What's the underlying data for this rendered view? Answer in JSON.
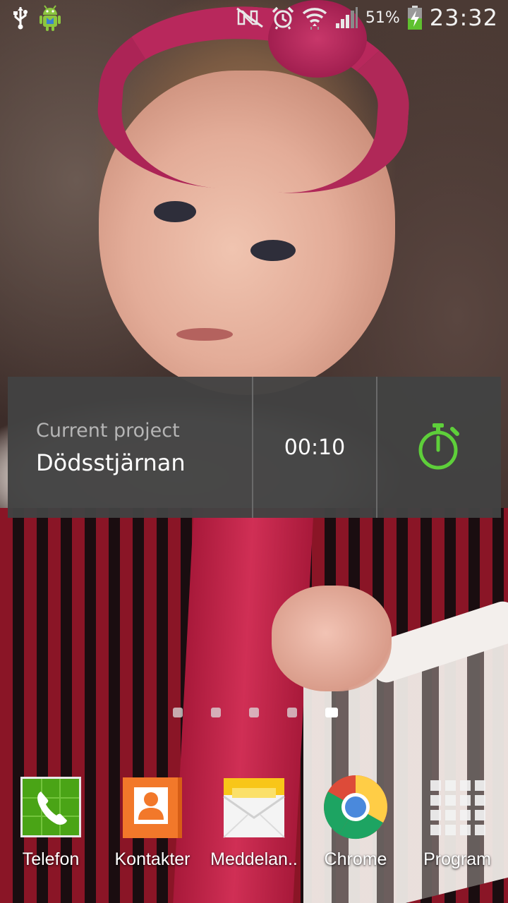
{
  "status_bar": {
    "left_icons": [
      "usb-icon",
      "android-debug-icon"
    ],
    "right_icons": [
      "nfc-muted-icon",
      "alarm-icon",
      "wifi-icon",
      "signal-icon",
      "battery-charging-icon"
    ],
    "battery_percent": "51%",
    "battery_level": 0.51,
    "clock": "23:32"
  },
  "widget": {
    "project_label": "Current project",
    "project_name": "Dödsstjärnan",
    "elapsed_time": "00:10",
    "start_icon": "stopwatch-icon",
    "accent_color": "#5ecf3a"
  },
  "pager": {
    "page_count": 5,
    "active_page": 5
  },
  "dock": {
    "items": [
      {
        "label": "Telefon",
        "icon": "phone-icon"
      },
      {
        "label": "Kontakter",
        "icon": "contacts-icon"
      },
      {
        "label": "Meddelan..",
        "icon": "messages-icon"
      },
      {
        "label": "Chrome",
        "icon": "chrome-icon"
      },
      {
        "label": "Program",
        "icon": "apps-grid-icon"
      }
    ]
  }
}
